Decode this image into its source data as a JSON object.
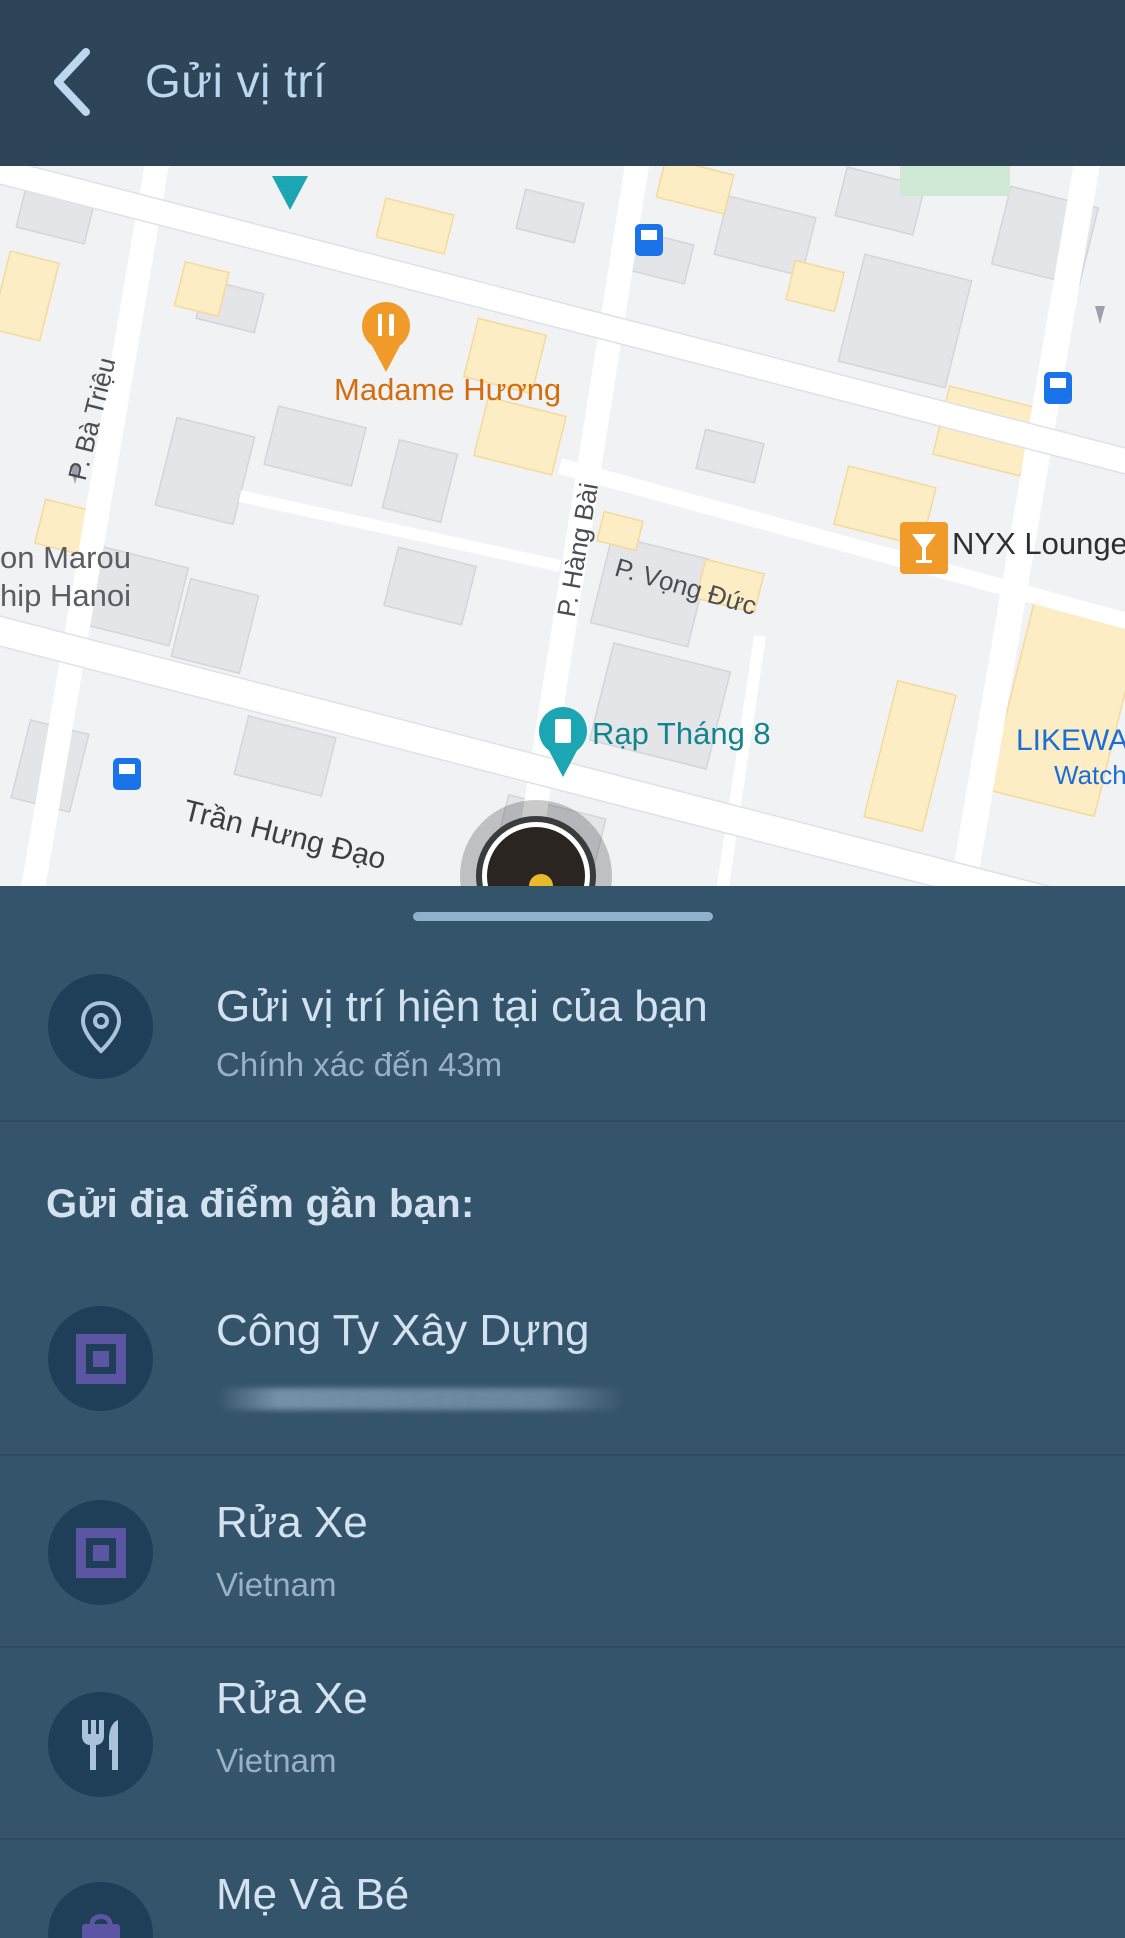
{
  "header": {
    "title": "Gửi vị trí",
    "back_icon": "chevron-left-icon"
  },
  "map": {
    "labels": {
      "madame_huong": "Madame Hương",
      "p_ba_trieu": "P. Bà Triệu",
      "p_hang_bai": "P. Hàng Bài",
      "p_vong_duc": "P. Vọng Đức",
      "nyx_lounge": "NYX Lounge",
      "marou_1": "on Marou",
      "marou_2": "hip Hanoi",
      "rap_thang_8": "Rạp Tháng 8",
      "likewa": "LIKEWA",
      "watch": "Watch",
      "tran_hung_dao": "Trần Hưng Đạo"
    },
    "colors": {
      "road": "#ffffff",
      "building": "#e3e5e9",
      "building_yellow": "#fdedc4",
      "restaurant_pin": "#f09a2a",
      "cinema_pin": "#1ca6b3",
      "bus_stop": "#1a73e8"
    }
  },
  "current_location": {
    "title": "Gửi vị trí hiện tại của bạn",
    "subtitle": "Chính xác đến 43m",
    "icon": "location-pin-icon"
  },
  "nearby": {
    "label": "Gửi địa điểm gần bạn:",
    "items": [
      {
        "title": "Công Ty Xây Dựng",
        "subtitle": "",
        "icon": "building-square-icon"
      },
      {
        "title": "Rửa Xe",
        "subtitle": "Vietnam",
        "icon": "building-square-icon"
      },
      {
        "title": "Rửa Xe",
        "subtitle": "Vietnam",
        "icon": "fork-knife-icon"
      },
      {
        "title": "Mẹ Và Bé",
        "subtitle": "",
        "icon": "shopping-bag-icon"
      }
    ]
  },
  "colors": {
    "header_bg": "#2d4459",
    "sheet_bg": "#34546b",
    "icon_circle": "#1f3e57",
    "icon_accent": "#5b55a3",
    "text_primary": "#d3e2ee",
    "text_secondary": "#98b1c4"
  }
}
